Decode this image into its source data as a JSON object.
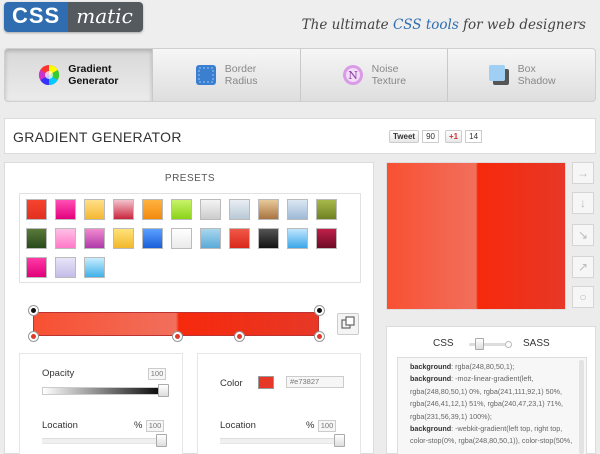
{
  "header": {
    "logo_left": "CSS",
    "logo_right": "matic",
    "tagline_pre": "The ultimate ",
    "tagline_accent": "CSS tools",
    "tagline_post": " for web designers"
  },
  "tabs": [
    {
      "line1": "Gradient",
      "line2": "Generator",
      "icon": "color-wheel-icon",
      "active": true
    },
    {
      "line1": "Border",
      "line2": "Radius",
      "icon": "border-radius-icon",
      "active": false
    },
    {
      "line1": "Noise",
      "line2": "Texture",
      "icon": "noise-texture-icon",
      "active": false
    },
    {
      "line1": "Box",
      "line2": "Shadow",
      "icon": "box-shadow-icon",
      "active": false
    }
  ],
  "title": "GRADIENT GENERATOR",
  "social": {
    "tweet_label": "Tweet",
    "tweet_count": "90",
    "gplus_label": "+1",
    "gplus_count": "14"
  },
  "presets": {
    "title": "PRESETS",
    "swatches": [
      "linear-gradient(#f6442e,#e0301f)",
      "linear-gradient(#ff4fb4,#e3007d)",
      "linear-gradient(#ffe08a,#f5b731)",
      "linear-gradient(#f3c3cd,#c9263c)",
      "linear-gradient(#ffb240,#f28a0d)",
      "linear-gradient(#c8f36a,#8ad31a)",
      "linear-gradient(#f3f3f3,#cccccc)",
      "linear-gradient(#e8eef3,#b9c8d5)",
      "linear-gradient(#e8c99a,#a87440)",
      "linear-gradient(#dbe7f3,#9db9d6)",
      "linear-gradient(#a7b84a,#6e8224)",
      "linear-gradient(#5a7a3a,#284a1c)",
      "linear-gradient(#ffc0e6,#ff78c8)",
      "linear-gradient(#f08ad0,#b03aa8)",
      "linear-gradient(#ffe27a,#f2b82c)",
      "linear-gradient(#5aa0ff,#1a5fd8)",
      "linear-gradient(#ffffff,#eaeaea)",
      "linear-gradient(#a8d6ee,#5aaad8)",
      "linear-gradient(#f05848,#d8281a)",
      "linear-gradient(#555555,#111111)",
      "linear-gradient(#bfe6ff,#3aa6e8)",
      "linear-gradient(#c0204a,#6e0a24)",
      "linear-gradient(#ff3aa6,#e0007a)",
      "linear-gradient(#e8e4f8,#c4bce8)",
      "linear-gradient(#c8ecff,#3eb0e8)"
    ]
  },
  "gradient": {
    "css": "linear-gradient(to right, #f85032 0%, #f16f5c 50%, #f6290c 51%, #f02f17 71%, #e73827 100%)"
  },
  "opacity": {
    "label": "Opacity",
    "value": "100"
  },
  "location_left": {
    "label": "Location",
    "unit": "%",
    "value": "100"
  },
  "color": {
    "label": "Color",
    "hex": "#e73827",
    "swatch": "#e73827"
  },
  "location_right": {
    "label": "Location",
    "unit": "%",
    "value": "100"
  },
  "side_buttons": [
    "→",
    "↓",
    "↘",
    "↗",
    "○"
  ],
  "code": {
    "css_label": "CSS",
    "sass_label": "SASS",
    "lines": [
      {
        "k": "background",
        "v": ": rgba(248,80,50,1);"
      },
      {
        "k": "background",
        "v": ": -moz-linear-gradient(left,"
      },
      {
        "k": "",
        "v": "rgba(248,80,50,1) 0%, rgba(241,111,92,1) 50%,"
      },
      {
        "k": "",
        "v": "rgba(246,41,12,1) 51%, rgba(240,47,23,1) 71%,"
      },
      {
        "k": "",
        "v": "rgba(231,56,39,1) 100%);"
      },
      {
        "k": "background",
        "v": ": -webkit-gradient(left top, right top,"
      },
      {
        "k": "",
        "v": "color-stop(0%, rgba(248,80,50,1)), color-stop(50%,"
      }
    ]
  }
}
